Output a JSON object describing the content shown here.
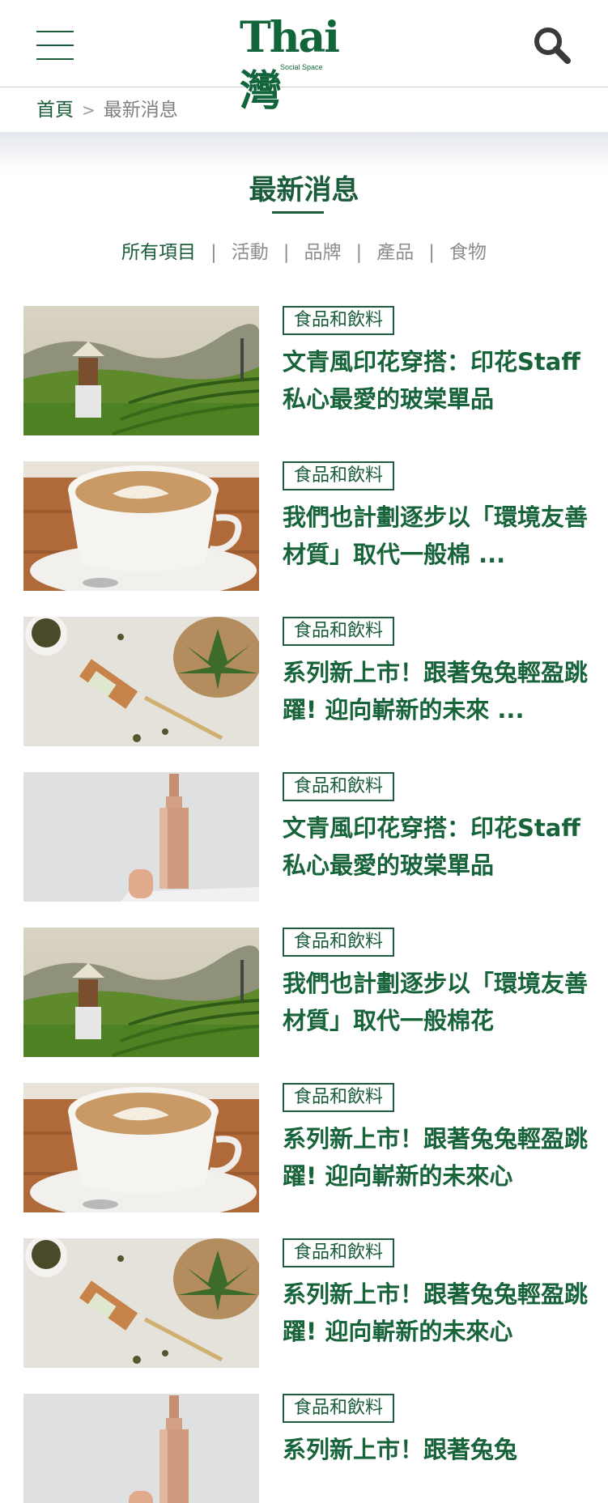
{
  "header": {
    "logo_text": "Thai灣",
    "logo_sub": "Social Space"
  },
  "breadcrumb": {
    "home": "首頁",
    "separator": ">",
    "current": "最新消息"
  },
  "page_title": "最新消息",
  "filters": [
    {
      "label": "所有項目",
      "active": true
    },
    {
      "label": "活動",
      "active": false
    },
    {
      "label": "品牌",
      "active": false
    },
    {
      "label": "產品",
      "active": false
    },
    {
      "label": "食物",
      "active": false
    }
  ],
  "filter_separator": "|",
  "articles": [
    {
      "tag": "食品和飲料",
      "title": "文青風印花穿搭：印花Staff私心最愛的玻棠單品",
      "image": "tea-plantation-photo"
    },
    {
      "tag": "食品和飲料",
      "title": "我們也計劃逐步以「環境友善材質」取代一般棉 ...",
      "image": "latte-art-photo"
    },
    {
      "tag": "食品和飲料",
      "title": "系列新上市！跟著兔兔輕盈跳躍! 迎向嶄新的未來 ...",
      "image": "cannabis-oil-photo"
    },
    {
      "tag": "食品和飲料",
      "title": "文青風印花穿搭：印花Staff私心最愛的玻棠單品",
      "image": "foundation-bottle-photo"
    },
    {
      "tag": "食品和飲料",
      "title": "我們也計劃逐步以「環境友善材質」取代一般棉花",
      "image": "tea-plantation-photo"
    },
    {
      "tag": "食品和飲料",
      "title": "系列新上市！跟著兔兔輕盈跳躍! 迎向嶄新的未來心",
      "image": "latte-art-photo"
    },
    {
      "tag": "食品和飲料",
      "title": "系列新上市！跟著兔兔輕盈跳躍! 迎向嶄新的未來心",
      "image": "cannabis-oil-photo"
    },
    {
      "tag": "食品和飲料",
      "title": "系列新上市！跟著兔兔",
      "image": "foundation-bottle-photo"
    }
  ],
  "colors": {
    "brand_green": "#1a5c3a",
    "muted_text": "#8d8d8d"
  }
}
